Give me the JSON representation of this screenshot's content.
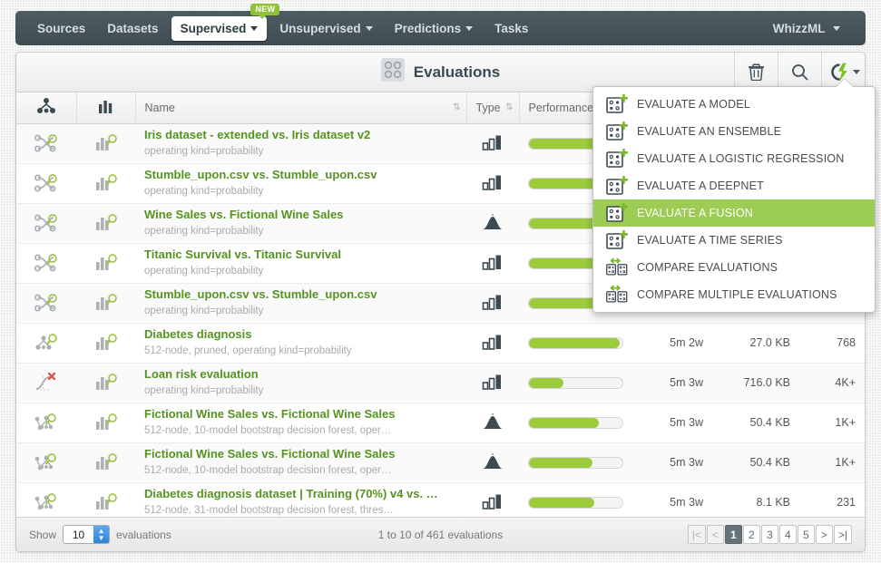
{
  "nav": {
    "items": [
      {
        "label": "Sources",
        "caret": false,
        "active": false,
        "badge": null
      },
      {
        "label": "Datasets",
        "caret": false,
        "active": false,
        "badge": null
      },
      {
        "label": "Supervised",
        "caret": true,
        "active": true,
        "badge": "NEW"
      },
      {
        "label": "Unsupervised",
        "caret": true,
        "active": false,
        "badge": null
      },
      {
        "label": "Predictions",
        "caret": true,
        "active": false,
        "badge": null
      },
      {
        "label": "Tasks",
        "caret": false,
        "active": false,
        "badge": null
      }
    ],
    "right": {
      "label": "WhizzML",
      "caret": true
    }
  },
  "header": {
    "title": "Evaluations",
    "grid_icon": "grid-icon",
    "actions": [
      {
        "name": "trash-icon",
        "label": "Delete"
      },
      {
        "name": "search-icon",
        "label": "Search"
      },
      {
        "name": "lightning-icon",
        "label": "Create"
      }
    ]
  },
  "table": {
    "columns": {
      "icon1": "model-icon",
      "icon2": "bars-icon",
      "name": "Name",
      "type": "Type",
      "performance": "Performance",
      "age": "",
      "size": "",
      "instances": ""
    },
    "rows": [
      {
        "icon": "fusion-search-icon",
        "icon2": "histogram-search-icon",
        "title": "Iris dataset - extended vs. Iris dataset v2",
        "subtitle": "operating kind=probability",
        "type": "classification-icon",
        "performance": 93,
        "age": "",
        "size": "",
        "instances": ""
      },
      {
        "icon": "fusion-search-icon",
        "icon2": "histogram-search-icon",
        "title": "Stumble_upon.csv vs. Stumble_upon.csv",
        "subtitle": "operating kind=probability",
        "type": "classification-icon",
        "performance": 100,
        "age": "",
        "size": "",
        "instances": ""
      },
      {
        "icon": "fusion-search-icon",
        "icon2": "histogram-search-icon",
        "title": "Wine Sales vs. Fictional Wine Sales",
        "subtitle": "operating kind=probability",
        "type": "regression-icon",
        "performance": 73,
        "age": "",
        "size": "",
        "instances": ""
      },
      {
        "icon": "fusion-search-icon",
        "icon2": "histogram-search-icon",
        "title": "Titanic Survival vs. Titanic Survival",
        "subtitle": "operating kind=probability",
        "type": "classification-icon",
        "performance": 85,
        "age": "",
        "size": "",
        "instances": ""
      },
      {
        "icon": "fusion-search-icon",
        "icon2": "histogram-search-icon",
        "title": "Stumble_upon.csv vs. Stumble_upon.csv",
        "subtitle": "operating kind=probability",
        "type": "classification-icon",
        "performance": 100,
        "age": "",
        "size": "",
        "instances": ""
      },
      {
        "icon": "tree-search-icon",
        "icon2": "histogram-search-icon",
        "title": "Diabetes diagnosis",
        "subtitle": "512-node, pruned, operating kind=probability",
        "type": "classification-icon",
        "performance": 97,
        "age": "5m 2w",
        "size": "27.0 KB",
        "instances": "768"
      },
      {
        "icon": "logistic-regression-search-icon",
        "icon2": "histogram-search-icon",
        "title": "Loan risk evaluation",
        "subtitle": "operating kind=probability",
        "type": "classification-icon",
        "performance": 37,
        "age": "5m 3w",
        "size": "716.0 KB",
        "instances": "4K+"
      },
      {
        "icon": "ensemble-search-icon",
        "icon2": "histogram-search-icon",
        "title": "Fictional Wine Sales vs. Fictional Wine Sales",
        "subtitle": "512-node, 10-model bootstrap decision forest, oper…",
        "type": "regression-icon",
        "performance": 75,
        "age": "5m 3w",
        "size": "50.4 KB",
        "instances": "1K+"
      },
      {
        "icon": "ensemble-search-icon",
        "icon2": "histogram-search-icon",
        "title": "Fictional Wine Sales vs. Fictional Wine Sales",
        "subtitle": "512-node, 10-model bootstrap decision forest, oper…",
        "type": "regression-icon",
        "performance": 68,
        "age": "5m 3w",
        "size": "50.4 KB",
        "instances": "1K+"
      },
      {
        "icon": "ensemble-search-icon",
        "icon2": "histogram-search-icon",
        "title": "Diabetes diagnosis dataset | Training (70%) v4 vs. …",
        "subtitle": "512-node, 31-model bootstrap decision forest, thres…",
        "type": "classification-icon",
        "performance": 70,
        "age": "5m 3w",
        "size": "8.1 KB",
        "instances": "231"
      }
    ]
  },
  "footer": {
    "show_label": "Show",
    "show_value": "10",
    "unit_label": "evaluations",
    "count_text": "1 to 10 of 461 evaluations",
    "pages": [
      "1",
      "2",
      "3",
      "4",
      "5"
    ],
    "current_page": "1",
    "first_label": "|<",
    "prev_label": "<",
    "next_label": ">",
    "last_label": ">|"
  },
  "menu": {
    "items": [
      {
        "label": "EVALUATE A MODEL",
        "icon": "evaluate-add-icon",
        "selected": false
      },
      {
        "label": "EVALUATE AN ENSEMBLE",
        "icon": "evaluate-add-icon",
        "selected": false
      },
      {
        "label": "EVALUATE A LOGISTIC REGRESSION",
        "icon": "evaluate-add-icon",
        "selected": false
      },
      {
        "label": "EVALUATE A DEEPNET",
        "icon": "evaluate-add-icon",
        "selected": false
      },
      {
        "label": "EVALUATE A FUSION",
        "icon": "evaluate-add-icon",
        "selected": true
      },
      {
        "label": "EVALUATE A TIME SERIES",
        "icon": "evaluate-add-icon",
        "selected": false
      },
      {
        "label": "COMPARE EVALUATIONS",
        "icon": "compare-icon",
        "selected": false
      },
      {
        "label": "COMPARE MULTIPLE EVALUATIONS",
        "icon": "compare-icon",
        "selected": false
      }
    ]
  },
  "colors": {
    "accent_green": "#9ccc3c",
    "menu_highlight": "#9ccc53",
    "link_green": "#55931f",
    "navbar_dark": "#44525a"
  }
}
